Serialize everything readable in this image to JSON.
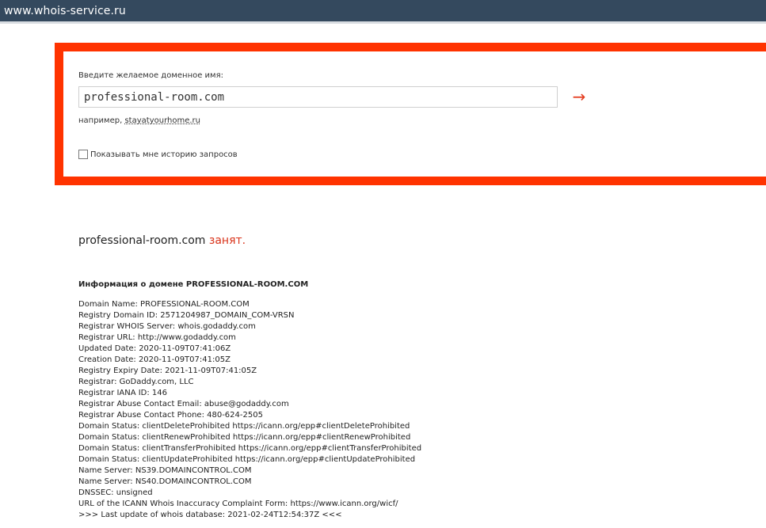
{
  "addressbar": {
    "url": "www.whois-service.ru"
  },
  "search": {
    "label": "Введите желаемое доменное имя:",
    "input_value": "professional-room.com",
    "submit_symbol": "→",
    "example_prefix": "например,",
    "example_link": "stayatyourhome.ru",
    "history_label": "Показывать мне историю запросов"
  },
  "result": {
    "domain": "professional-room.com",
    "status": "занят."
  },
  "info": {
    "heading": "Информация о домене PROFESSIONAL-ROOM.COM",
    "lines": [
      "Domain Name: PROFESSIONAL-ROOM.COM",
      "Registry Domain ID: 2571204987_DOMAIN_COM-VRSN",
      "Registrar WHOIS Server: whois.godaddy.com",
      "Registrar URL: http://www.godaddy.com",
      "Updated Date: 2020-11-09T07:41:06Z",
      "Creation Date: 2020-11-09T07:41:05Z",
      "Registry Expiry Date: 2021-11-09T07:41:05Z",
      "Registrar: GoDaddy.com, LLC",
      "Registrar IANA ID: 146",
      "Registrar Abuse Contact Email: abuse@godaddy.com",
      "Registrar Abuse Contact Phone: 480-624-2505",
      "Domain Status: clientDeleteProhibited https://icann.org/epp#clientDeleteProhibited",
      "Domain Status: clientRenewProhibited https://icann.org/epp#clientRenewProhibited",
      "Domain Status: clientTransferProhibited https://icann.org/epp#clientTransferProhibited",
      "Domain Status: clientUpdateProhibited https://icann.org/epp#clientUpdateProhibited",
      "Name Server: NS39.DOMAINCONTROL.COM",
      "Name Server: NS40.DOMAINCONTROL.COM",
      "DNSSEC: unsigned",
      "URL of the ICANN Whois Inaccuracy Complaint Form: https://www.icann.org/wicf/",
      ">>> Last update of whois database: 2021-02-24T12:54:37Z <<<"
    ]
  }
}
